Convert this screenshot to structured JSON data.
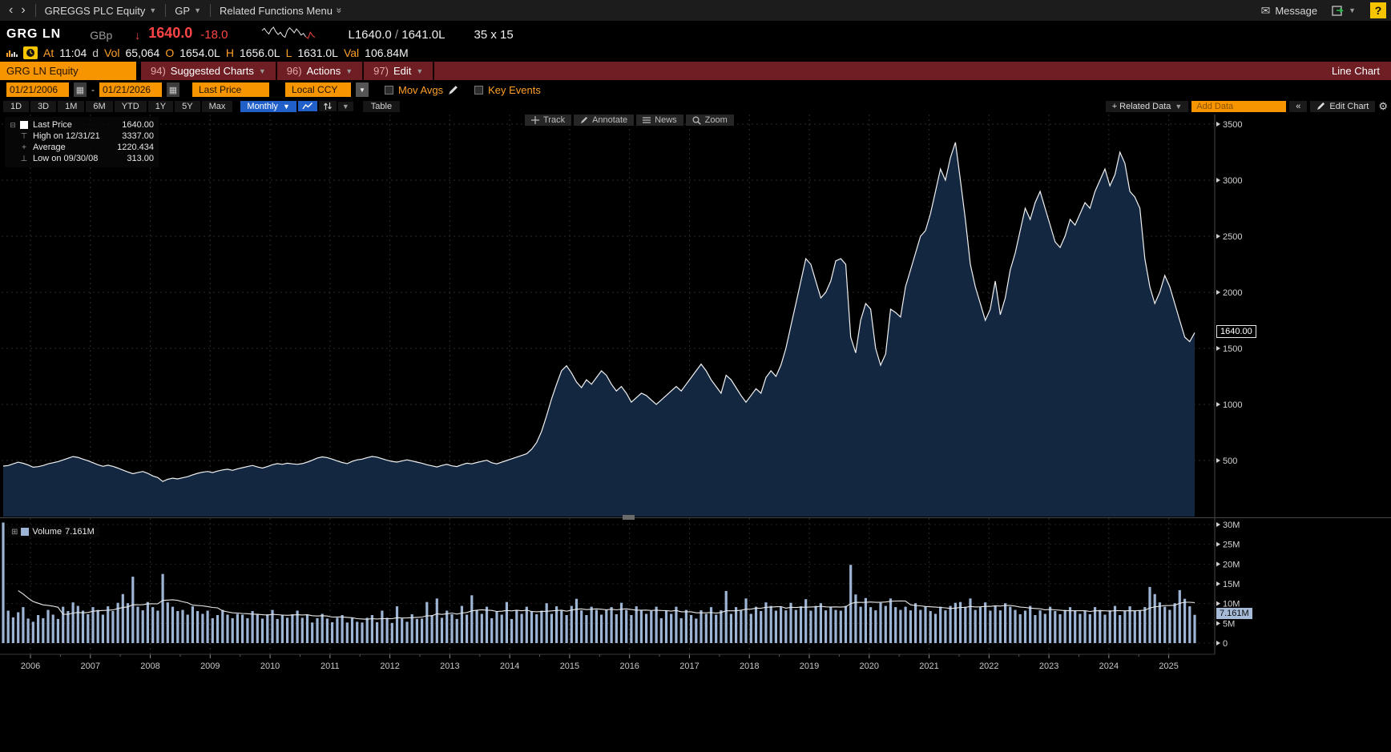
{
  "top_bar": {
    "back": "‹",
    "forward": "›",
    "security_menu": "GREGGS PLC Equity",
    "function_code": "GP",
    "related_menu": "Related Functions Menu",
    "message": "Message",
    "help": "?"
  },
  "quote": {
    "ticker": "GRG LN",
    "currency": "GBp",
    "down_arrow": "↓",
    "last": "1640.0",
    "change": "-18.0",
    "bid": "L1640.0",
    "sep": "/",
    "ask": "1641.0L",
    "lot_size": "35 x 15",
    "at_label": "At",
    "time": "11:04",
    "delay_flag": "d",
    "vol_label": "Vol",
    "vol": "65,064",
    "open_label": "O",
    "open": "1654.0L",
    "high_label": "H",
    "high": "1656.0L",
    "low_label": "L",
    "low": "1631.0L",
    "val_label": "Val",
    "val": "106.84M"
  },
  "menu": {
    "tab": "GRG LN Equity",
    "items": [
      {
        "num": "94)",
        "label": "Suggested Charts"
      },
      {
        "num": "96)",
        "label": "Actions"
      },
      {
        "num": "97)",
        "label": "Edit"
      }
    ],
    "right_label": "Line Chart"
  },
  "controls": {
    "date_from": "01/21/2006",
    "date_sep": "-",
    "date_to": "01/21/2026",
    "price_field": "Last Price",
    "currency_field": "Local CCY",
    "mov_avgs": "Mov Avgs",
    "key_events": "Key Events"
  },
  "period": {
    "ranges": [
      "1D",
      "3D",
      "1M",
      "6M",
      "YTD",
      "1Y",
      "5Y",
      "Max"
    ],
    "interval": "Monthly",
    "table": "Table",
    "related_data": "+ Related Data",
    "add_data": "Add Data",
    "collapse": "«",
    "edit_chart": "Edit Chart"
  },
  "chart_toolbar": {
    "buttons": [
      "Track",
      "Annotate",
      "News",
      "Zoom"
    ]
  },
  "legend": {
    "items": [
      {
        "label": "Last Price",
        "value": "1640.00"
      },
      {
        "label": "High on 12/31/21",
        "value": "3337.00"
      },
      {
        "label": "Average",
        "value": "1220.434"
      },
      {
        "label": "Low on 09/30/08",
        "value": "313.00"
      }
    ]
  },
  "volume_legend": {
    "label": "Volume",
    "value": "7.161M"
  },
  "badges": {
    "last_price": "1640.00",
    "volume": "7.161M"
  },
  "chart_data": {
    "type": "area",
    "title": "GRG LN Equity Last Price",
    "interval": "Monthly",
    "date_range": "01/21/2006 - 01/21/2026",
    "x_years": [
      2006,
      2007,
      2008,
      2009,
      2010,
      2011,
      2012,
      2013,
      2014,
      2015,
      2016,
      2017,
      2018,
      2019,
      2020,
      2021,
      2022,
      2023,
      2024,
      2025
    ],
    "price_axis": {
      "ticks": [
        3500,
        3000,
        2500,
        2000,
        1500,
        1000,
        500
      ],
      "labels": [
        "3500",
        "3000",
        "2500",
        "2000",
        "1500",
        "1000",
        "500"
      ],
      "last": 1640.0,
      "high": 3337.0,
      "average": 1220.434,
      "low": 313.0
    },
    "volume_axis": {
      "ticks": [
        30,
        25,
        20,
        15,
        10,
        5,
        0
      ],
      "labels": [
        "30M",
        "25M",
        "20M",
        "15M",
        "10M",
        "5M",
        "0"
      ],
      "last": 7.161,
      "unit": "M"
    },
    "price_monthly": [
      [
        450,
        455,
        470,
        485,
        475,
        460,
        440,
        445,
        455,
        470,
        480,
        490
      ],
      [
        505,
        520,
        535,
        528,
        512,
        498,
        480,
        462,
        448,
        458,
        448,
        432
      ],
      [
        415,
        398,
        382,
        392,
        402,
        386,
        362,
        348,
        313,
        332,
        342,
        336
      ],
      [
        346,
        356,
        372,
        386,
        396,
        402,
        392,
        406,
        416,
        422,
        412,
        426
      ],
      [
        436,
        446,
        456,
        442,
        432,
        446,
        462,
        472,
        466,
        476,
        470,
        466
      ],
      [
        472,
        486,
        502,
        522,
        532,
        526,
        512,
        496,
        482,
        472,
        492,
        506
      ],
      [
        512,
        526,
        536,
        530,
        516,
        502,
        492,
        486,
        496,
        506,
        496,
        486
      ],
      [
        476,
        462,
        452,
        442,
        456,
        466,
        452,
        446,
        462,
        476,
        470,
        482
      ],
      [
        492,
        502,
        480,
        470,
        485,
        500,
        515,
        530,
        545,
        560,
        600,
        660
      ],
      [
        760,
        900,
        1050,
        1180,
        1300,
        1345,
        1280,
        1200,
        1150,
        1220,
        1180,
        1240
      ],
      [
        1300,
        1260,
        1180,
        1120,
        1160,
        1100,
        1020,
        1060,
        1100,
        1080,
        1040,
        1000
      ],
      [
        1040,
        1080,
        1120,
        1160,
        1120,
        1180,
        1240,
        1300,
        1360,
        1300,
        1220,
        1160
      ],
      [
        1100,
        1260,
        1220,
        1150,
        1080,
        1020,
        1080,
        1140,
        1100,
        1240,
        1300,
        1250
      ],
      [
        1350,
        1500,
        1700,
        1900,
        2100,
        2300,
        2250,
        2100,
        1950,
        2000,
        2100,
        2280
      ],
      [
        2300,
        2250,
        1600,
        1460,
        1750,
        1900,
        1850,
        1500,
        1350,
        1450,
        1850,
        1820
      ],
      [
        1780,
        2050,
        2200,
        2350,
        2500,
        2550,
        2700,
        2900,
        3100,
        3000,
        3200,
        3337
      ],
      [
        3000,
        2650,
        2250,
        2050,
        1900,
        1750,
        1850,
        2100,
        1800,
        1950,
        2200,
        2350
      ],
      [
        2550,
        2750,
        2650,
        2800,
        2900,
        2750,
        2600,
        2450,
        2400,
        2500,
        2650,
        2600
      ],
      [
        2700,
        2800,
        2750,
        2900,
        3000,
        3100,
        2950,
        3050,
        3250,
        3150,
        2900,
        2850
      ],
      [
        2750,
        2300,
        2050,
        1900,
        2000,
        2150,
        2050,
        1900,
        1750,
        1600,
        1560,
        1640
      ]
    ],
    "volume_monthly_m": [
      [
        30.5,
        8.2,
        6.5,
        7.8,
        9.1,
        6.2,
        5.4,
        7.1,
        6.3,
        8.4,
        7.2,
        6.1
      ],
      [
        9.2,
        8.1,
        10.3,
        9.4,
        8.2,
        7.3,
        9.1,
        8.4,
        7.2,
        9.3,
        8.1,
        10.2
      ],
      [
        12.4,
        10.1,
        16.8,
        9.2,
        8.3,
        10.4,
        9.1,
        8.2,
        17.5,
        10.3,
        9.2,
        8.1
      ],
      [
        8.4,
        7.2,
        9.3,
        8.1,
        7.4,
        8.2,
        6.3,
        7.1,
        8.4,
        7.2,
        6.3,
        7.4
      ],
      [
        7.2,
        6.3,
        8.1,
        7.4,
        6.2,
        7.3,
        8.4,
        6.1,
        7.2,
        6.4,
        7.3,
        8.2
      ],
      [
        6.4,
        7.1,
        5.2,
        6.3,
        7.4,
        6.2,
        5.3,
        6.4,
        7.1,
        5.2,
        6.3,
        5.4
      ],
      [
        5.2,
        6.4,
        7.1,
        5.3,
        8.2,
        6.4,
        5.1,
        9.3,
        6.2,
        5.4,
        7.3,
        6.1
      ],
      [
        6.2,
        10.4,
        7.1,
        11.3,
        6.4,
        8.2,
        7.3,
        6.1,
        9.4,
        7.2,
        12.1,
        8.3
      ],
      [
        7.4,
        9.2,
        6.3,
        8.1,
        7.2,
        10.4,
        6.1,
        8.3,
        7.4,
        9.2,
        8.1,
        7.3
      ],
      [
        8.2,
        10.1,
        7.4,
        9.3,
        8.2,
        7.1,
        9.4,
        11.2,
        8.3,
        7.1,
        9.2,
        8.4
      ],
      [
        7.2,
        8.4,
        9.1,
        7.3,
        10.2,
        8.4,
        7.1,
        9.3,
        8.2,
        7.4,
        8.1,
        9.2
      ],
      [
        6.3,
        8.1,
        7.4,
        9.2,
        6.3,
        8.4,
        7.1,
        6.2,
        8.3,
        7.4,
        9.1,
        7.2
      ],
      [
        8.3,
        13.2,
        7.4,
        9.1,
        8.2,
        11.3,
        7.4,
        9.2,
        8.1,
        10.3,
        9.4,
        8.2
      ],
      [
        9.1,
        8.3,
        10.2,
        8.4,
        9.3,
        11.1,
        8.2,
        9.4,
        10.1,
        8.3,
        9.2,
        8.4
      ],
      [
        8.2,
        9.4,
        19.8,
        12.3,
        9.2,
        11.4,
        9.1,
        8.3,
        10.2,
        9.4,
        11.3,
        9.1
      ],
      [
        8.4,
        9.2,
        8.3,
        10.1,
        8.4,
        9.3,
        8.1,
        7.4,
        9.2,
        8.3,
        9.4,
        10.2
      ],
      [
        10.4,
        9.2,
        11.3,
        8.4,
        9.1,
        10.3,
        8.2,
        9.4,
        8.3,
        10.1,
        9.2,
        8.4
      ],
      [
        7.3,
        8.2,
        9.4,
        7.1,
        8.3,
        7.4,
        9.2,
        8.1,
        7.3,
        8.4,
        9.1,
        8.3
      ],
      [
        7.4,
        8.2,
        7.3,
        9.1,
        8.4,
        7.2,
        8.3,
        9.4,
        7.1,
        8.2,
        9.3,
        8.1
      ],
      [
        8.3,
        9.1,
        14.2,
        12.4,
        10.3,
        9.2,
        8.4,
        10.1,
        13.4,
        11.2,
        9.3,
        7.161
      ]
    ],
    "sparkline": [
      1652,
      1656,
      1650,
      1646,
      1654,
      1658,
      1650,
      1645,
      1649,
      1643,
      1640,
      1652,
      1657,
      1653,
      1648,
      1655,
      1650,
      1644,
      1647,
      1641,
      1638,
      1649,
      1643,
      1640
    ],
    "colors": {
      "line": "#f2f2f2",
      "area": "#132741",
      "volume_bar": "#9db4d4",
      "grid": "#2c2c2c",
      "axis_text": "#d4d4d4",
      "accent_orange": "#f79500",
      "down_red": "#ff4545",
      "interval_blue": "#2160c8",
      "menu_maroon": "#6f1e24"
    }
  }
}
